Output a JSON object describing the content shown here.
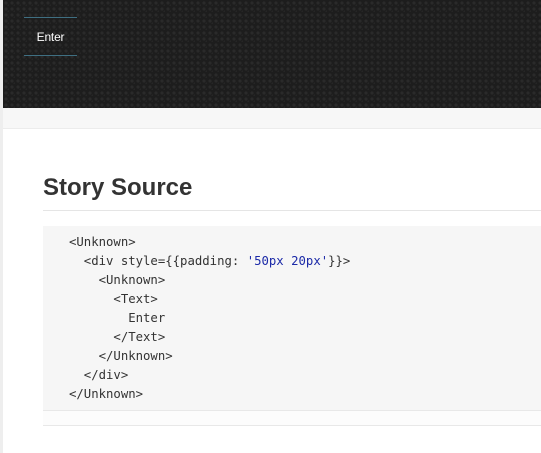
{
  "preview": {
    "button_label": "Enter"
  },
  "story_source": {
    "title": "Story Source",
    "code": {
      "l1": "<Unknown>",
      "l2_pre": "  <div style={{padding: ",
      "l2_str": "'50px 20px'",
      "l2_post": "}}>",
      "l3": "    <Unknown>",
      "l4": "      <Text>",
      "l5": "        Enter",
      "l6": "      </Text>",
      "l7": "    </Unknown>",
      "l8": "  </div>",
      "l9": "</Unknown>"
    }
  },
  "colors": {
    "preview_bg": "#1d1d1d",
    "button_border": "#3f6f82",
    "code_bg": "#f6f6f6",
    "string_literal": "#1c2aa8"
  }
}
